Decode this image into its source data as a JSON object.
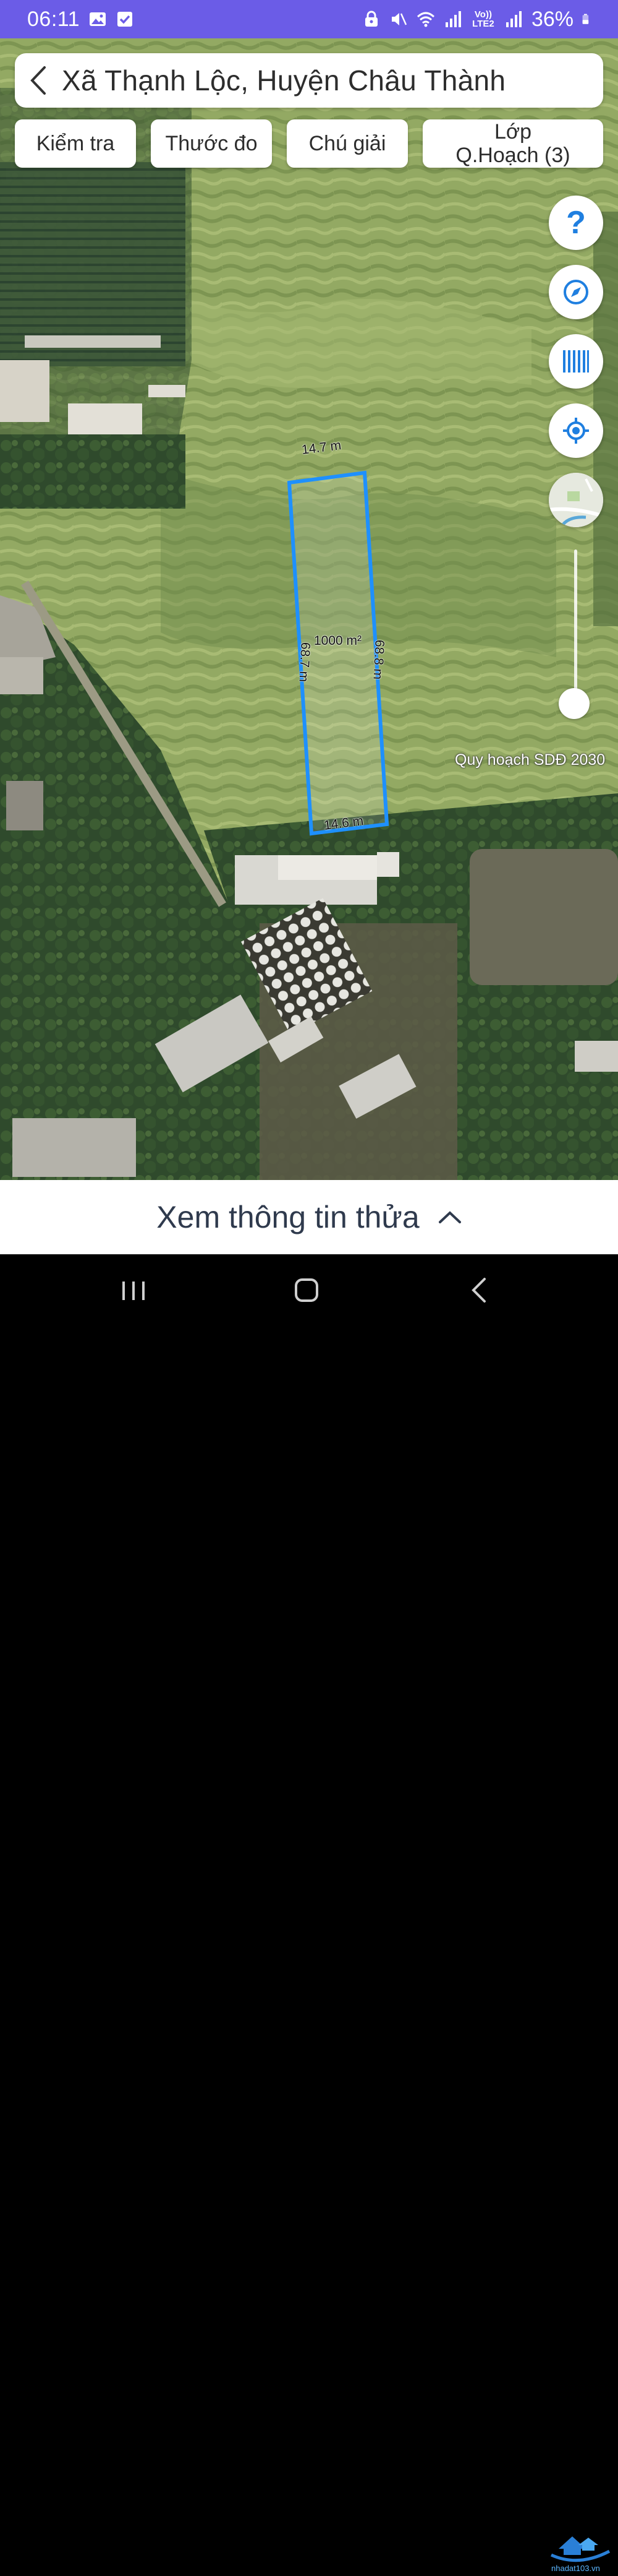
{
  "status_bar": {
    "time": "06:11",
    "network_label": "Vo)) LTE2",
    "battery": "36%",
    "background_color": "#6b5ce7"
  },
  "header": {
    "back_icon": "chevron-left-icon",
    "title": "Xã Thạnh Lộc, Huyện Châu Thành"
  },
  "toolbar": {
    "chips": [
      {
        "label": "Kiểm tra"
      },
      {
        "label": "Thước đo"
      },
      {
        "label": "Chú giải"
      },
      {
        "label": "Lớp Q.Hoạch (3)"
      }
    ]
  },
  "map_controls": {
    "help": "?",
    "icons": [
      "question-icon",
      "compass-icon",
      "barcode-icon",
      "locate-icon",
      "map-thumbnail-icon"
    ],
    "accent_color": "#1f7fe0",
    "zoom_level": 0.1
  },
  "parcel": {
    "edges": {
      "top": "14.7 m",
      "bottom": "14.6 m",
      "left": "68.7 m",
      "right": "68.8 m"
    },
    "area": "1000 m²",
    "outline_color": "#1e90ff"
  },
  "map_caption": "Quy hoạch SDĐ 2030",
  "bottom_sheet": {
    "title": "Xem thông tin thửa",
    "icon": "chevron-up-icon"
  },
  "nav_bar": {
    "buttons": [
      "recents-icon",
      "home-icon",
      "back-icon"
    ]
  },
  "watermark": {
    "text": "nhadat103.vn"
  }
}
